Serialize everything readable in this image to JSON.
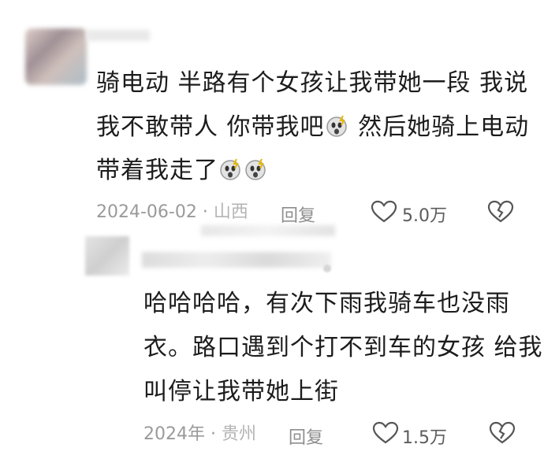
{
  "comment1": {
    "lines": [
      "骑电动 半路有个女孩让我带她一段  我说",
      "我不敢带人  你带我吧",
      "  然后她骑上电动",
      "带着我走了"
    ],
    "date": "2024-06-02",
    "location": "山西",
    "reply_label": "回复",
    "likes": "5.0万",
    "emoji_icon": "scared-face-icon"
  },
  "comment2": {
    "lines": [
      "哈哈哈哈，有次下雨我骑车也没雨",
      "衣。路口遇到个打不到车的女孩 给我",
      "叫停让我带她上街"
    ],
    "date": "2024年",
    "location": "贵州",
    "reply_label": "回复",
    "likes": "1.5万"
  },
  "colors": {
    "text": "#1c1c1c",
    "meta": "#9a9a9a",
    "icon": "#555555"
  }
}
